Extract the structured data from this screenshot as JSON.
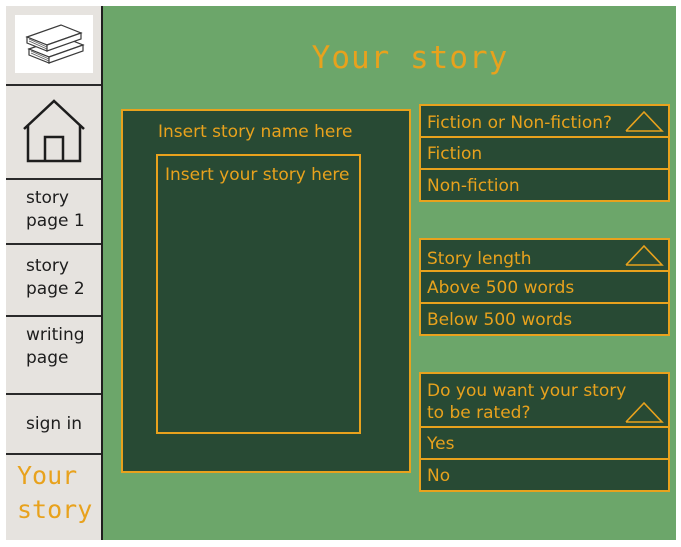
{
  "sidebar": {
    "logo_icon": "books-icon",
    "home_icon": "home-icon",
    "items": [
      {
        "label_line1": "story",
        "label_line2": "page 1"
      },
      {
        "label_line1": "story",
        "label_line2": "page 2"
      },
      {
        "label_line1": "writing",
        "label_line2": "page"
      }
    ],
    "sign_in": "sign in",
    "brand_line1": "Your",
    "brand_line2": "story"
  },
  "main": {
    "title": "Your story",
    "story_name_placeholder": "Insert story name here",
    "story_body_placeholder": "Insert your story here"
  },
  "dropdowns": [
    {
      "header": "Fiction or Non-fiction?",
      "options": [
        "Fiction",
        "Non-fiction"
      ]
    },
    {
      "header": "Story length",
      "options": [
        "Above 500 words",
        "Below 500 words"
      ]
    },
    {
      "header_line1": "Do you want your story",
      "header_line2": "to be rated?",
      "options": [
        "Yes",
        "No"
      ]
    }
  ],
  "colors": {
    "background": "#6ca66a",
    "panel": "#284a34",
    "accent": "#e8a21d",
    "sidebar": "#e6e3df"
  }
}
